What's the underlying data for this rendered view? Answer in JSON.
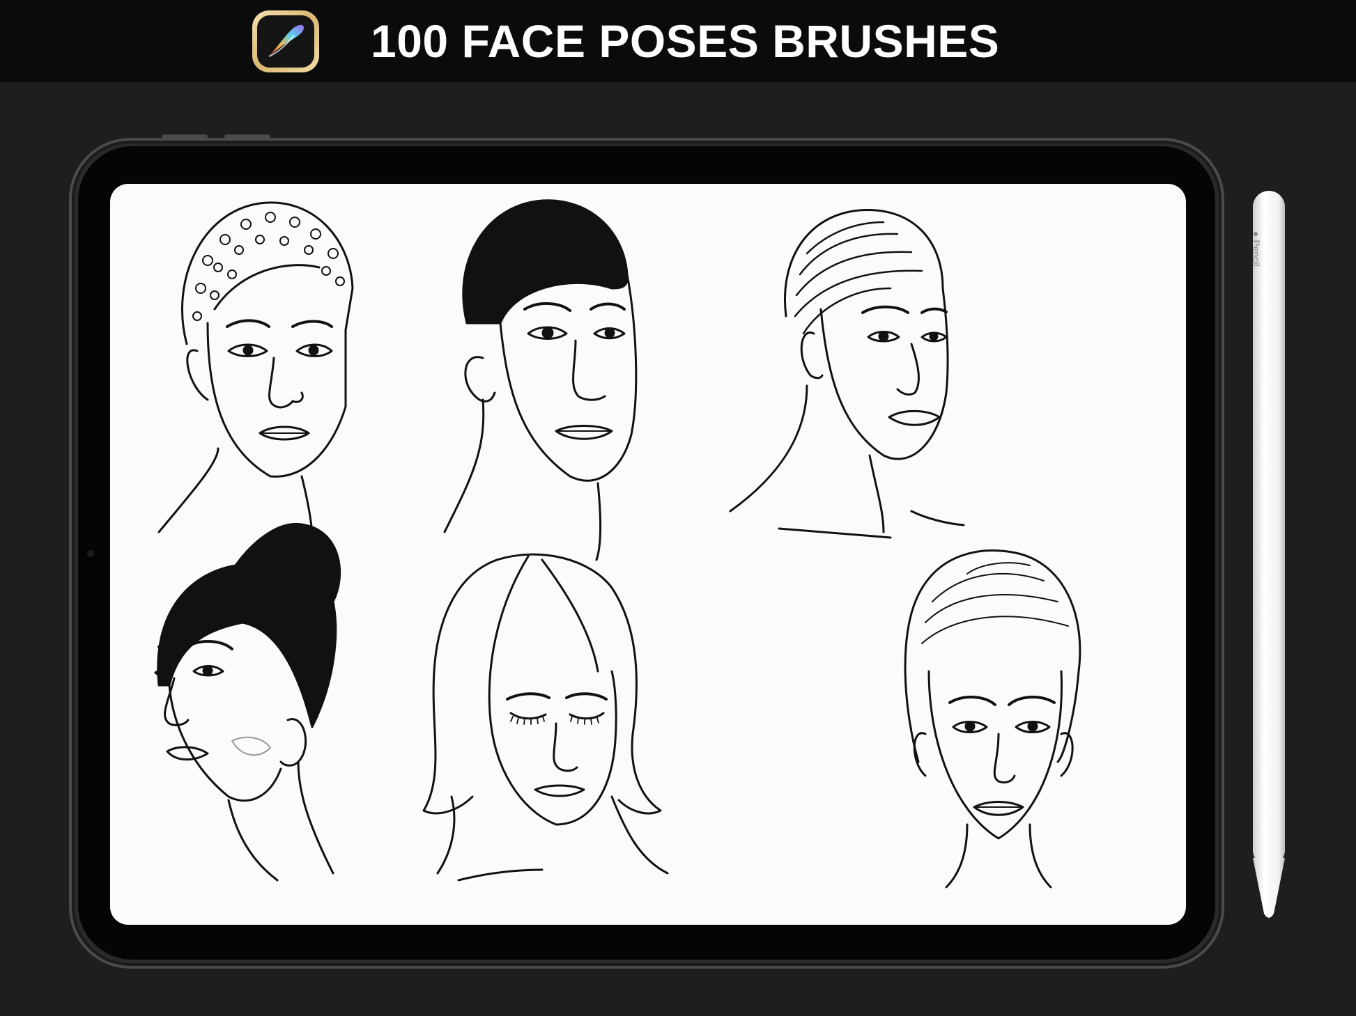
{
  "header": {
    "title": "100 FACE POSES BRUSHES",
    "logo_icon": "procreate-app-icon"
  },
  "device": {
    "type": "tablet",
    "stylus_label": "Pencil",
    "stylus_icon": "apple-logo-icon"
  },
  "gallery": {
    "items": [
      {
        "name": "face-short-curly-hair"
      },
      {
        "name": "face-short-cropped-hair"
      },
      {
        "name": "face-braided-hair"
      },
      {
        "name": "face-hair-bun"
      },
      {
        "name": "face-shoulder-length-hair"
      },
      {
        "name": "face-slicked-back-hair"
      }
    ]
  },
  "colors": {
    "background": "#1e1e1e",
    "topbar": "#0b0b0b",
    "title": "#ffffff",
    "screen": "#fbfbfb",
    "line_art": "#111111"
  }
}
